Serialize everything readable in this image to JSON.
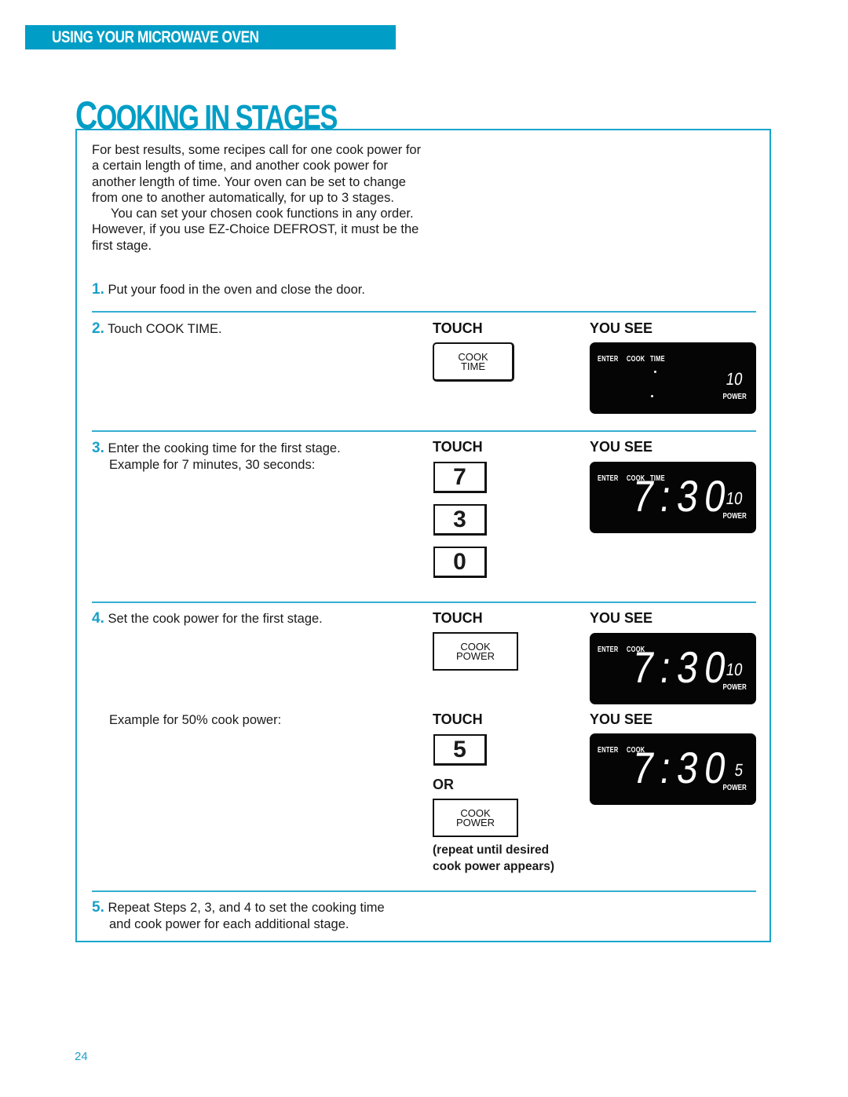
{
  "header": {
    "section": "USING YOUR MICROWAVE OVEN",
    "title_first": "C",
    "title_rest": "OOKING IN STAGES"
  },
  "intro": {
    "para1": "For best results, some recipes call for one cook power for a certain length of time, and another cook power for another length of time. Your oven can be set to change from one to another automatically, for up to 3 stages.",
    "para2": "You can set your chosen cook functions in any order. However, if you use EZ-Choice DEFROST, it must be the first stage."
  },
  "columns": {
    "touch": "TOUCH",
    "you_see": "YOU SEE"
  },
  "steps": [
    {
      "num": "1.",
      "text": "Put your food in the oven and close the door."
    },
    {
      "num": "2.",
      "text": "Touch COOK TIME.",
      "button": [
        "COOK",
        "TIME"
      ],
      "display": {
        "labels": [
          "ENTER",
          "COOK",
          "TIME"
        ],
        "time": "",
        "power": "10",
        "power_label": "POWER"
      }
    },
    {
      "num": "3.",
      "text": "Enter the cooking time for the first stage.",
      "sub": "Example for 7 minutes, 30 seconds:",
      "keys": [
        "7",
        "3",
        "0"
      ],
      "display": {
        "labels": [
          "ENTER",
          "COOK",
          "TIME"
        ],
        "time": "7:30",
        "power": "10",
        "power_label": "POWER"
      }
    },
    {
      "num": "4.",
      "text": "Set the cook power for the first stage.",
      "button": [
        "COOK",
        "POWER"
      ],
      "display": {
        "labels": [
          "ENTER",
          "COOK"
        ],
        "time": "7:30",
        "power": "10",
        "power_label": "POWER"
      },
      "example": "Example for 50% cook power:",
      "example_key": "5",
      "or": "OR",
      "example_button": [
        "COOK",
        "POWER"
      ],
      "note": [
        "(repeat until desired",
        "cook power appears)"
      ],
      "example_display": {
        "labels": [
          "ENTER",
          "COOK"
        ],
        "time": "7:30",
        "power": "5",
        "power_label": "POWER"
      }
    },
    {
      "num": "5.",
      "text": "Repeat Steps 2, 3, and 4 to set the cooking time",
      "sub": "and cook power for each additional stage."
    }
  ],
  "page_number": "24",
  "colors": {
    "accent": "#009ec6",
    "display_bg": "#050505"
  }
}
